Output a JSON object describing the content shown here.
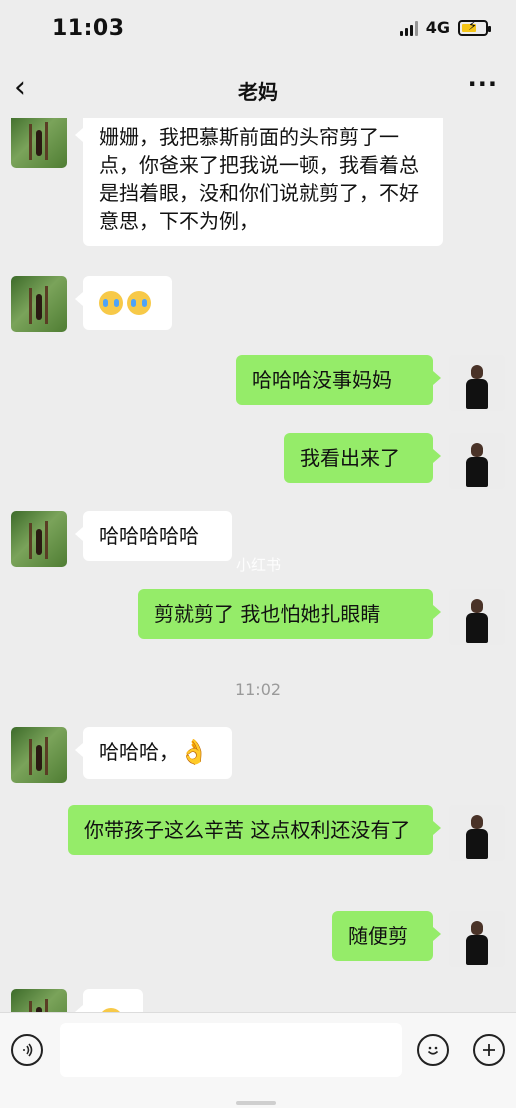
{
  "status": {
    "time": "11:03",
    "network": "4G"
  },
  "nav": {
    "back_icon": "chevron-left",
    "title": "老妈",
    "more_icon": "ellipsis"
  },
  "messages": [
    {
      "sender": "mom",
      "text": "姗姗，我把慕斯前面的头帘剪了一点，你爸来了把我说一顿，我看着总是挡着眼，没和你们说就剪了，不好意思，下不为例，"
    },
    {
      "sender": "mom",
      "text": "",
      "emoji": "crying-laughing x2"
    },
    {
      "sender": "me",
      "text": "哈哈哈没事妈妈"
    },
    {
      "sender": "me",
      "text": "我看出来了"
    },
    {
      "sender": "mom",
      "text": "哈哈哈哈哈"
    },
    {
      "sender": "me",
      "text": "剪就剪了 我也怕她扎眼睛"
    },
    {
      "timestamp": "11:02"
    },
    {
      "sender": "mom",
      "text": "哈哈哈，",
      "emoji": "ok-hand"
    },
    {
      "sender": "me",
      "text": "你带孩子这么辛苦 这点权利还没有了"
    },
    {
      "sender": "me",
      "text": "随便剪"
    },
    {
      "sender": "mom",
      "text": "",
      "emoji": "partial"
    }
  ],
  "watermark": "小红书",
  "input_bar": {
    "voice_icon": "voice",
    "emoji_icon": "smiley",
    "add_icon": "plus"
  },
  "colors": {
    "background": "#ededed",
    "outgoing": "#95ec69",
    "incoming": "#ffffff"
  }
}
